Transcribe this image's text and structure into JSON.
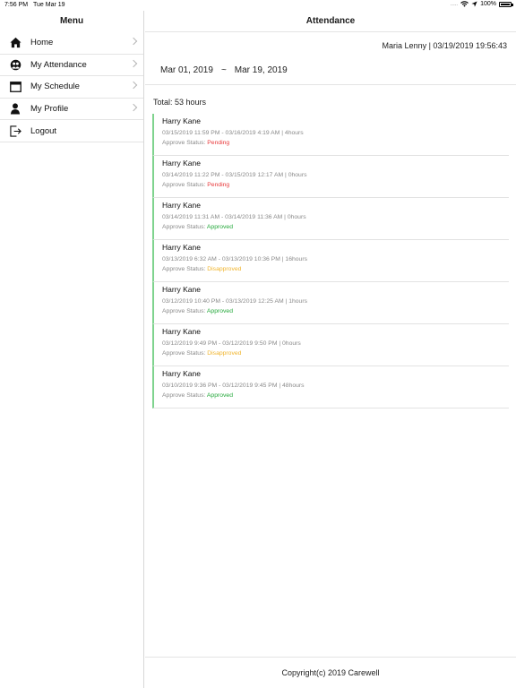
{
  "status_bar": {
    "time": "7:56 PM",
    "date": "Tue Mar 19",
    "signal_dots": ".....",
    "battery_text": "100%",
    "battery_level": 1.0
  },
  "sidebar": {
    "title": "Menu",
    "items": [
      {
        "label": "Home",
        "icon": "home-icon",
        "chevron": true
      },
      {
        "label": "My Attendance",
        "icon": "attendance-icon",
        "chevron": true
      },
      {
        "label": "My Schedule",
        "icon": "calendar-icon",
        "chevron": true
      },
      {
        "label": "My Profile",
        "icon": "person-icon",
        "chevron": true
      },
      {
        "label": "Logout",
        "icon": "logout-icon",
        "chevron": false
      }
    ]
  },
  "main": {
    "title": "Attendance",
    "user_line": "Maria Lenny | 03/19/2019 19:56:43",
    "date_range": {
      "start": "Mar 01, 2019",
      "separator": "~",
      "end": "Mar 19, 2019"
    },
    "total": "Total: 53 hours",
    "status_label": "Approve Status:",
    "records": [
      {
        "name": "Harry Kane",
        "times": "03/15/2019 11:59 PM - 03/16/2019 4:19 AM | 4hours",
        "status": "Pending"
      },
      {
        "name": "Harry Kane",
        "times": "03/14/2019 11:22 PM - 03/15/2019 12:17 AM | 0hours",
        "status": "Pending"
      },
      {
        "name": "Harry Kane",
        "times": "03/14/2019 11:31 AM - 03/14/2019 11:36 AM | 0hours",
        "status": "Approved"
      },
      {
        "name": "Harry Kane",
        "times": "03/13/2019 6:32 AM - 03/13/2019 10:36 PM | 16hours",
        "status": "Disapproved"
      },
      {
        "name": "Harry Kane",
        "times": "03/12/2019 10:40 PM - 03/13/2019 12:25 AM | 1hours",
        "status": "Approved"
      },
      {
        "name": "Harry Kane",
        "times": "03/12/2019 9:49 PM - 03/12/2019 9:50 PM | 0hours",
        "status": "Disapproved"
      },
      {
        "name": "Harry Kane",
        "times": "03/10/2019 9:36 PM - 03/12/2019 9:45 PM | 48hours",
        "status": "Approved"
      }
    ],
    "footer": "Copyright(c) 2019 Carewell"
  },
  "colors": {
    "pending": "#e8393b",
    "approved": "#24a83a",
    "disapproved": "#f0b42c",
    "record_accent": "#7fd38e"
  }
}
